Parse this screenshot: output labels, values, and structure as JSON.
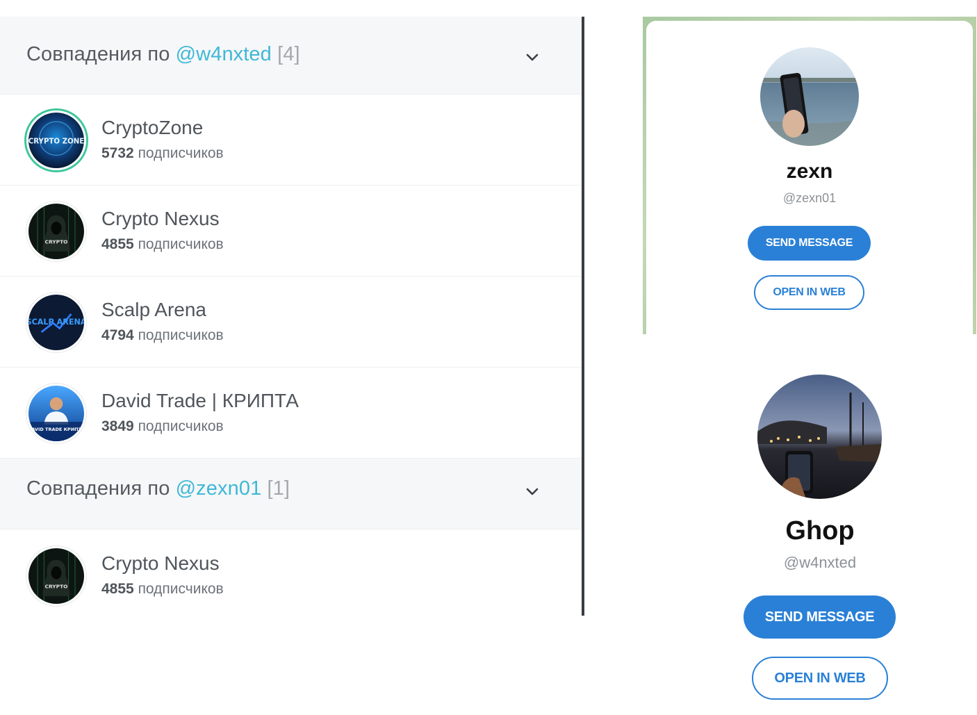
{
  "groups": [
    {
      "prefix": "Совпадения по",
      "handle": "@w4nxted",
      "count": "[4]",
      "rows": [
        {
          "name": "CryptoZone",
          "subs_count": "5732",
          "subs_label": "подписчиков"
        },
        {
          "name": "Crypto Nexus",
          "subs_count": "4855",
          "subs_label": "подписчиков"
        },
        {
          "name": "Scalp Arena",
          "subs_count": "4794",
          "subs_label": "подписчиков"
        },
        {
          "name": "David Trade | КРИПТА",
          "subs_count": "3849",
          "subs_label": "подписчиков"
        }
      ]
    },
    {
      "prefix": "Совпадения по",
      "handle": "@zexn01",
      "count": "[1]",
      "rows": [
        {
          "name": "Crypto Nexus",
          "subs_count": "4855",
          "subs_label": "подписчиков"
        }
      ]
    }
  ],
  "avatar_text": {
    "cryptozone": "CRYPTO ZONE",
    "nexus": "CRYPTO",
    "scalp": "SCALP ARENA",
    "david": "DAVID TRADE КРИПТА"
  },
  "profiles": [
    {
      "name": "zexn",
      "handle": "@zexn01",
      "send_label": "SEND MESSAGE",
      "web_label": "OPEN IN WEB"
    },
    {
      "name": "Ghop",
      "handle": "@w4nxted",
      "send_label": "SEND MESSAGE",
      "web_label": "OPEN IN WEB"
    }
  ],
  "colors": {
    "accent_handle": "#3fb8d8",
    "telegram_blue": "#2a80d6",
    "ring_green": "#3cc79a"
  },
  "icons": {
    "group_toggle": "chevron-down-icon"
  }
}
